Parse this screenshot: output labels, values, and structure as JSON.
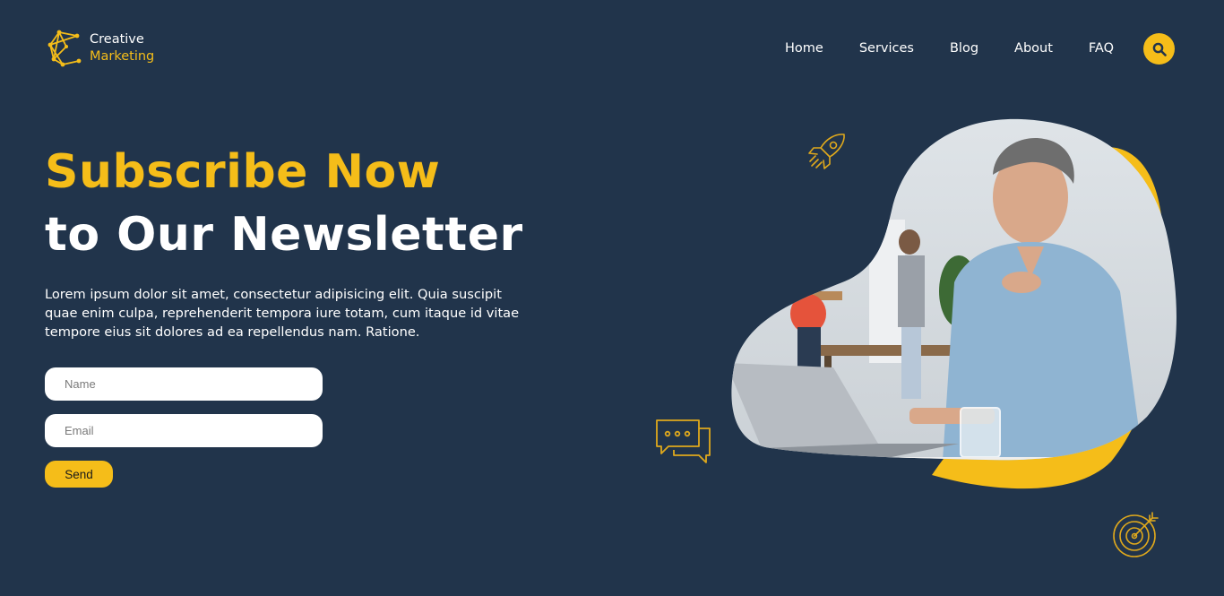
{
  "brand": {
    "line1": "Creative",
    "line2": "Marketing",
    "icon": "polygon-network-logo-icon"
  },
  "nav": {
    "items": [
      "Home",
      "Services",
      "Blog",
      "About",
      "FAQ"
    ]
  },
  "search": {
    "icon": "search-icon"
  },
  "hero": {
    "headline_1": "Subscribe Now",
    "headline_2": "to Our Newsletter",
    "lead": "Lorem ipsum dolor sit amet, consectetur adipisicing elit. Quia suscipit quae enim culpa, reprehenderit tempora iure totam, cum itaque id vitae tempore eius sit dolores ad ea repellendus nam. Ratione."
  },
  "form": {
    "name_placeholder": "Name",
    "email_placeholder": "Email",
    "send_label": "Send"
  },
  "decorations": [
    "rocket-icon",
    "chat-bubbles-icon",
    "target-icon"
  ],
  "colors": {
    "background": "#21344b",
    "accent": "#f5bd19",
    "text": "#ffffff"
  }
}
